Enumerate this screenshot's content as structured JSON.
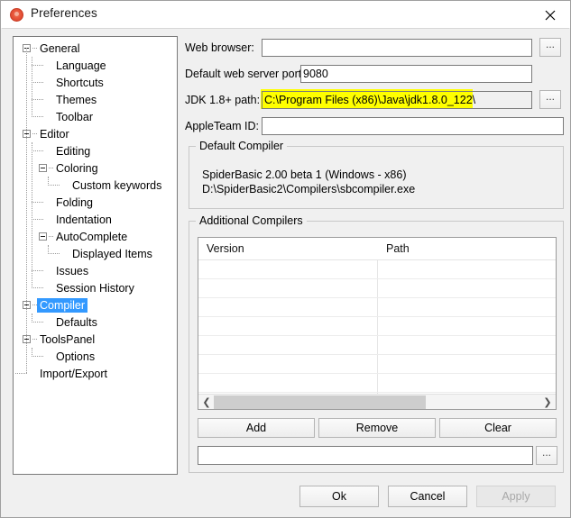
{
  "window": {
    "title": "Preferences",
    "icon": "app-circle-icon",
    "close_icon": "close-icon"
  },
  "sidebar": {
    "name": "preferences-category-tree",
    "selected": "Compiler",
    "items": [
      {
        "label": "General",
        "depth": 0,
        "expander": "collapse-box",
        "selected": false
      },
      {
        "label": "Language",
        "depth": 1,
        "expander": "none",
        "selected": false
      },
      {
        "label": "Shortcuts",
        "depth": 1,
        "expander": "none",
        "selected": false
      },
      {
        "label": "Themes",
        "depth": 1,
        "expander": "none",
        "selected": false
      },
      {
        "label": "Toolbar",
        "depth": 1,
        "expander": "none",
        "selected": false
      },
      {
        "label": "Editor",
        "depth": 0,
        "expander": "collapse-box",
        "selected": false
      },
      {
        "label": "Editing",
        "depth": 1,
        "expander": "none",
        "selected": false
      },
      {
        "label": "Coloring",
        "depth": 1,
        "expander": "collapse-box",
        "selected": false
      },
      {
        "label": "Custom keywords",
        "depth": 2,
        "expander": "none",
        "selected": false
      },
      {
        "label": "Folding",
        "depth": 1,
        "expander": "none",
        "selected": false
      },
      {
        "label": "Indentation",
        "depth": 1,
        "expander": "none",
        "selected": false
      },
      {
        "label": "AutoComplete",
        "depth": 1,
        "expander": "collapse-box",
        "selected": false
      },
      {
        "label": "Displayed Items",
        "depth": 2,
        "expander": "none",
        "selected": false
      },
      {
        "label": "Issues",
        "depth": 1,
        "expander": "none",
        "selected": false
      },
      {
        "label": "Session History",
        "depth": 1,
        "expander": "none",
        "selected": false
      },
      {
        "label": "Compiler",
        "depth": 0,
        "expander": "collapse-box",
        "selected": true
      },
      {
        "label": "Defaults",
        "depth": 1,
        "expander": "none",
        "selected": false
      },
      {
        "label": "ToolsPanel",
        "depth": 0,
        "expander": "collapse-box",
        "selected": false
      },
      {
        "label": "Options",
        "depth": 1,
        "expander": "none",
        "selected": false
      },
      {
        "label": "Import/Export",
        "depth": 0,
        "expander": "none",
        "selected": false
      }
    ]
  },
  "form": {
    "web_browser": {
      "label": "Web browser:",
      "value": "",
      "browse_label": "..."
    },
    "web_server_port": {
      "label": "Default web server port:",
      "value": "9080"
    },
    "jdk_path": {
      "label": "JDK 1.8+ path:",
      "value": "C:\\Program Files (x86)\\Java\\jdk1.8.0_122\\",
      "browse_label": "...",
      "highlight_color": "#ffff00",
      "highlighted": true
    },
    "apple_team_id": {
      "label": "AppleTeam ID:",
      "value": ""
    }
  },
  "default_compiler": {
    "title": "Default Compiler",
    "lines": [
      "SpiderBasic 2.00 beta 1 (Windows - x86)",
      "D:\\SpiderBasic2\\Compilers\\sbcompiler.exe"
    ]
  },
  "additional_compilers": {
    "title": "Additional Compilers",
    "table": {
      "columns": [
        "Version",
        "Path"
      ],
      "rows": []
    },
    "scrollbar": {
      "left_arrow": "❮",
      "right_arrow": "❯"
    },
    "buttons": [
      {
        "label": "Add",
        "enabled": true
      },
      {
        "label": "Remove",
        "enabled": true
      },
      {
        "label": "Clear",
        "enabled": true
      }
    ],
    "path_field": {
      "value": "",
      "browse_label": "..."
    }
  },
  "dialog_buttons": [
    {
      "label": "Ok",
      "enabled": true
    },
    {
      "label": "Cancel",
      "enabled": true
    },
    {
      "label": "Apply",
      "enabled": false
    }
  ]
}
